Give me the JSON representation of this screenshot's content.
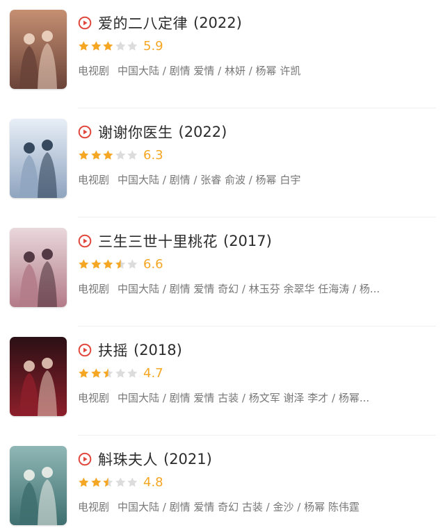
{
  "colors": {
    "accent": "#e0483e",
    "star_filled": "#f5a623",
    "star_empty": "#dcdcdc",
    "muted_text": "#777777"
  },
  "items": [
    {
      "title": "爱的二八定律",
      "year": "(2022)",
      "rating": "5.9",
      "stars": 3,
      "type": "电视剧",
      "meta": "中国大陆 / 剧情 爱情 / 林妍 / 杨幂 许凯",
      "poster_icon": "poster-romance-couple",
      "poster_colors": [
        "#c58f72",
        "#6a4338",
        "#f0d6c4"
      ]
    },
    {
      "title": "谢谢你医生",
      "year": "(2022)",
      "rating": "6.3",
      "stars": 3,
      "type": "电视剧",
      "meta": "中国大陆 / 剧情 / 张睿 俞波 / 杨幂 白宇",
      "poster_icon": "poster-doctor-drama",
      "poster_colors": [
        "#e7eef7",
        "#8fa4bf",
        "#26384e"
      ]
    },
    {
      "title": "三生三世十里桃花",
      "year": "(2017)",
      "rating": "6.6",
      "stars": 3.5,
      "type": "电视剧",
      "meta": "中国大陆 / 剧情 爱情 奇幻 / 林玉芬 余翠华 任海涛 / 杨...",
      "poster_icon": "poster-fantasy-group",
      "poster_colors": [
        "#e9d8dc",
        "#b37b88",
        "#452b35"
      ]
    },
    {
      "title": "扶摇",
      "year": "(2018)",
      "rating": "4.7",
      "stars": 2.5,
      "type": "电视剧",
      "meta": "中国大陆 / 剧情 爱情 古装 / 杨文军 谢泽 李才 / 杨幂...",
      "poster_icon": "poster-dark-portrait",
      "poster_colors": [
        "#2b1015",
        "#8c1f2a",
        "#e4c6b8"
      ]
    },
    {
      "title": "斛珠夫人",
      "year": "(2021)",
      "rating": "4.8",
      "stars": 2.5,
      "type": "电视剧",
      "meta": "中国大陆 / 剧情 爱情 奇幻 古装 / 金沙 / 杨幂 陈伟霆",
      "poster_icon": "poster-teal-costume",
      "poster_colors": [
        "#8fb7b5",
        "#3f6f70",
        "#eef0ea"
      ]
    }
  ]
}
